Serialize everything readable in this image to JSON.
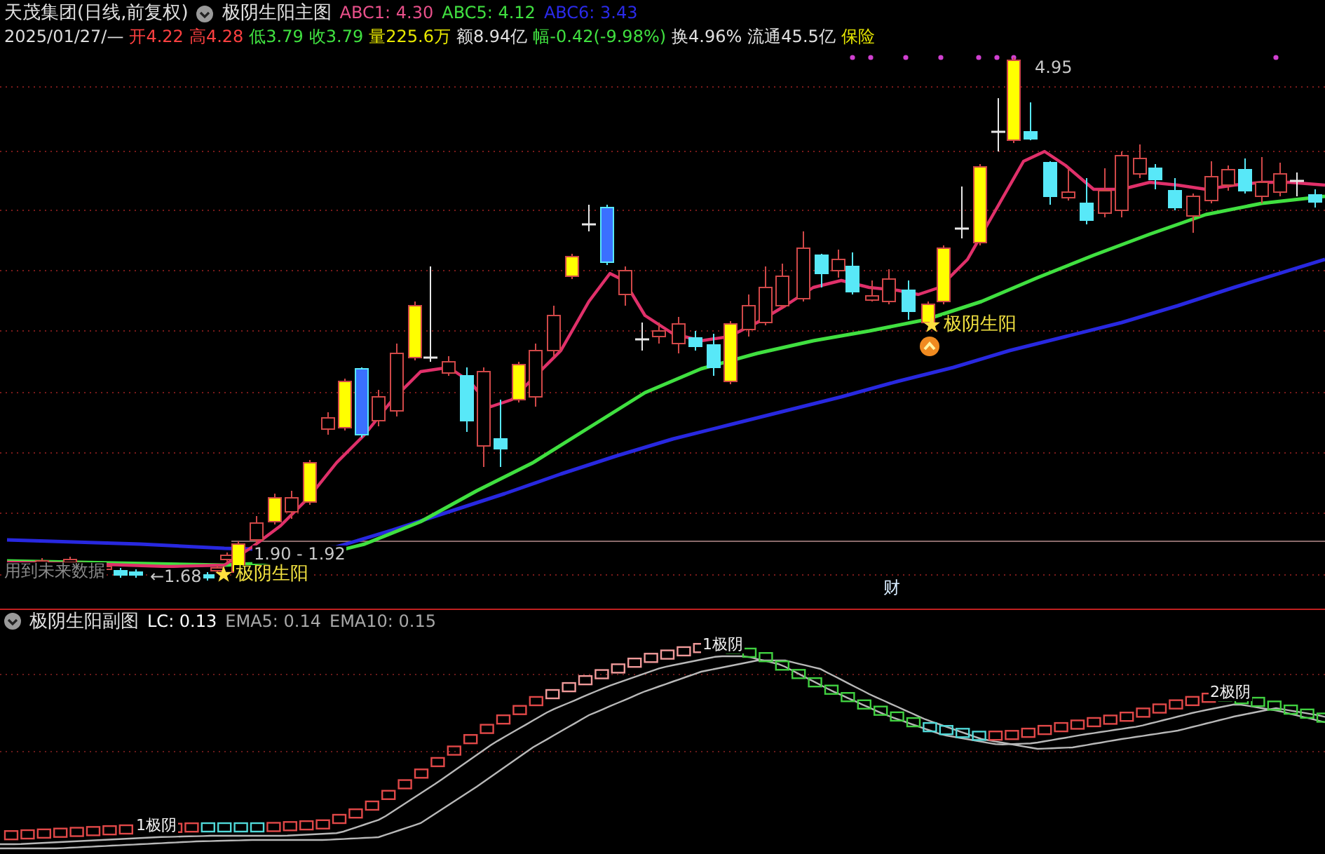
{
  "header": {
    "title": "天茂集团(日线,前复权)",
    "indicator": "极阴生阳主图",
    "readouts": [
      {
        "text": "ABC1: 4.30",
        "color": "#e8508a"
      },
      {
        "text": "ABC5: 4.12",
        "color": "#40e040"
      },
      {
        "text": "ABC6: 3.43",
        "color": "#2a2ae8"
      }
    ]
  },
  "quote": {
    "date": "2025/01/27/—",
    "items": [
      {
        "text": "开4.22",
        "color": "#ff4040"
      },
      {
        "text": "高4.28",
        "color": "#ff4040"
      },
      {
        "text": "低3.79",
        "color": "#40e040"
      },
      {
        "text": "收3.79",
        "color": "#40e040"
      },
      {
        "text": "量225.6万",
        "color": "#e8e800"
      },
      {
        "text": "额8.94亿",
        "color": "#e0e0e0"
      },
      {
        "text": "幅-0.42(-9.98%)",
        "color": "#40e040"
      },
      {
        "text": "换4.96%",
        "color": "#e0e0e0"
      },
      {
        "text": "流通45.5亿",
        "color": "#e0e0e0"
      },
      {
        "text": "保险",
        "color": "#e8e800"
      }
    ]
  },
  "main_chart": {
    "annotations": [
      {
        "kind": "price",
        "text": "4.95"
      },
      {
        "kind": "price",
        "text": "1.90 - 1.92"
      },
      {
        "kind": "price",
        "text": "←1.68"
      },
      {
        "kind": "signal",
        "text": "极阴生阳"
      },
      {
        "kind": "signal",
        "text": "极阴生阳"
      },
      {
        "kind": "note",
        "text": "用到未来数据"
      },
      {
        "kind": "marker",
        "text": "财"
      }
    ]
  },
  "sub_header": {
    "title": "极阴生阳副图",
    "readouts": [
      {
        "text": "LC: 0.13",
        "color": "#ffffff"
      },
      {
        "text": "EMA5: 0.14",
        "color": "#a8a8a8"
      },
      {
        "text": "EMA10: 0.15",
        "color": "#a8a8a8"
      }
    ]
  },
  "sub_chart": {
    "labels": [
      {
        "text": "1极阴"
      },
      {
        "text": "2极阴"
      },
      {
        "text": "1极阴"
      }
    ]
  }
}
